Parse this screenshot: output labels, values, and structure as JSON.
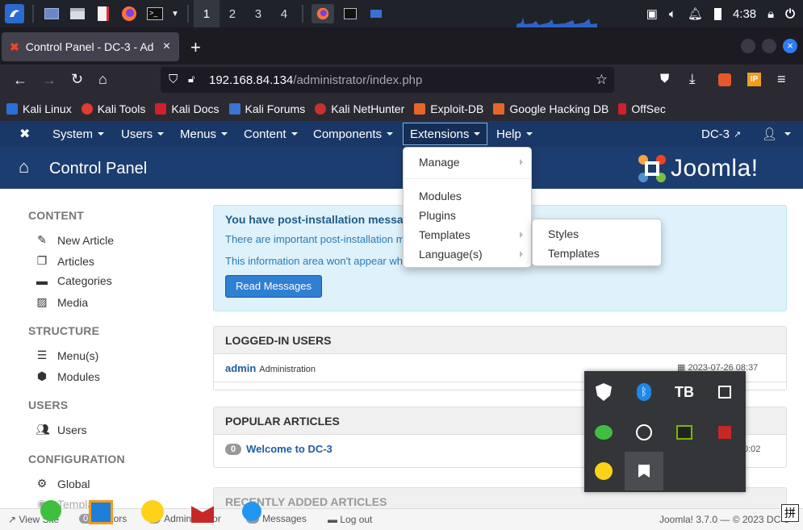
{
  "taskbar": {
    "workspaces": [
      "1",
      "2",
      "3",
      "4"
    ],
    "clock": "4:38"
  },
  "browser": {
    "tab_title": "Control Panel - DC-3 - Ad",
    "url_host": "192.168.84.134",
    "url_path": "/administrator/index.php",
    "bookmarks": [
      "Kali Linux",
      "Kali Tools",
      "Kali Docs",
      "Kali Forums",
      "Kali NetHunter",
      "Exploit-DB",
      "Google Hacking DB",
      "OffSec"
    ],
    "ip_badge": "IP"
  },
  "joomla_nav": {
    "menus": [
      "System",
      "Users",
      "Menus",
      "Content",
      "Components",
      "Extensions",
      "Help"
    ],
    "site_name": "DC-3"
  },
  "header": {
    "title": "Control Panel",
    "logo_text": "Joomla!"
  },
  "extensions_menu": {
    "items": [
      "Manage",
      "Modules",
      "Plugins",
      "Templates",
      "Language(s)"
    ],
    "templates_submenu": [
      "Styles",
      "Templates"
    ]
  },
  "sidebar": {
    "content_head": "CONTENT",
    "content_items": [
      "New Article",
      "Articles",
      "Categories",
      "Media"
    ],
    "structure_head": "STRUCTURE",
    "structure_items": [
      "Menu(s)",
      "Modules"
    ],
    "users_head": "USERS",
    "users_items": [
      "Users"
    ],
    "config_head": "CONFIGURATION",
    "config_items": [
      "Global",
      "Templates"
    ]
  },
  "alert": {
    "title": "You have post-installation messa",
    "line1": "There are important post-installation m",
    "line2": "This information area won't appear wh",
    "button": "Read Messages"
  },
  "logged_in": {
    "head": "LOGGED-IN USERS",
    "user": "admin",
    "role": "Administration",
    "time": "2023-07-26 08:37"
  },
  "popular": {
    "head": "POPULAR ARTICLES",
    "count": "0",
    "title": "Welcome to DC-3",
    "time": "0:02"
  },
  "recent": {
    "head": "RECENTLY ADDED ARTICLES"
  },
  "statusbar": {
    "view_site": "View Site",
    "visitors_count": "0",
    "visitors": "Visitors",
    "admin_count": "1",
    "admin": "Administrator",
    "messages_count": "0",
    "messages": "Messages",
    "logout": "Log out",
    "version": "Joomla! 3.7.0 — © 2023 DC-3",
    "ime": "拼"
  },
  "colors": {
    "joomla_nav": "#1a3867",
    "joomla_header": "#1c3d6f",
    "link": "#1f5ca4",
    "button": "#2f7fd2",
    "alert_bg": "#dff1fa"
  }
}
